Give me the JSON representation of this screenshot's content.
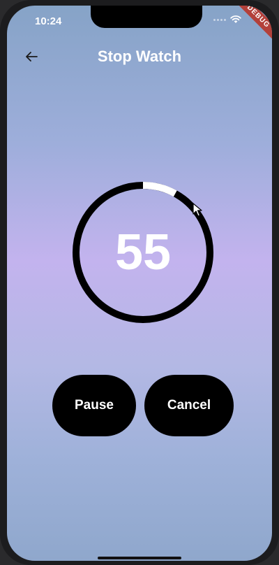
{
  "status_bar": {
    "time": "10:24",
    "debug_label": "DEBUG"
  },
  "app_bar": {
    "title": "Stop Watch",
    "back_icon": "arrow-left-icon"
  },
  "timer": {
    "value": "55",
    "progress_fraction": 0.08,
    "ring_color": "#000000",
    "progress_color": "#ffffff"
  },
  "buttons": {
    "pause_label": "Pause",
    "cancel_label": "Cancel"
  },
  "colors": {
    "gradient_top": "#86a3c7",
    "gradient_mid": "#c3b3ee",
    "gradient_bottom": "#8fa7cc",
    "button_bg": "#000000",
    "text": "#ffffff"
  }
}
